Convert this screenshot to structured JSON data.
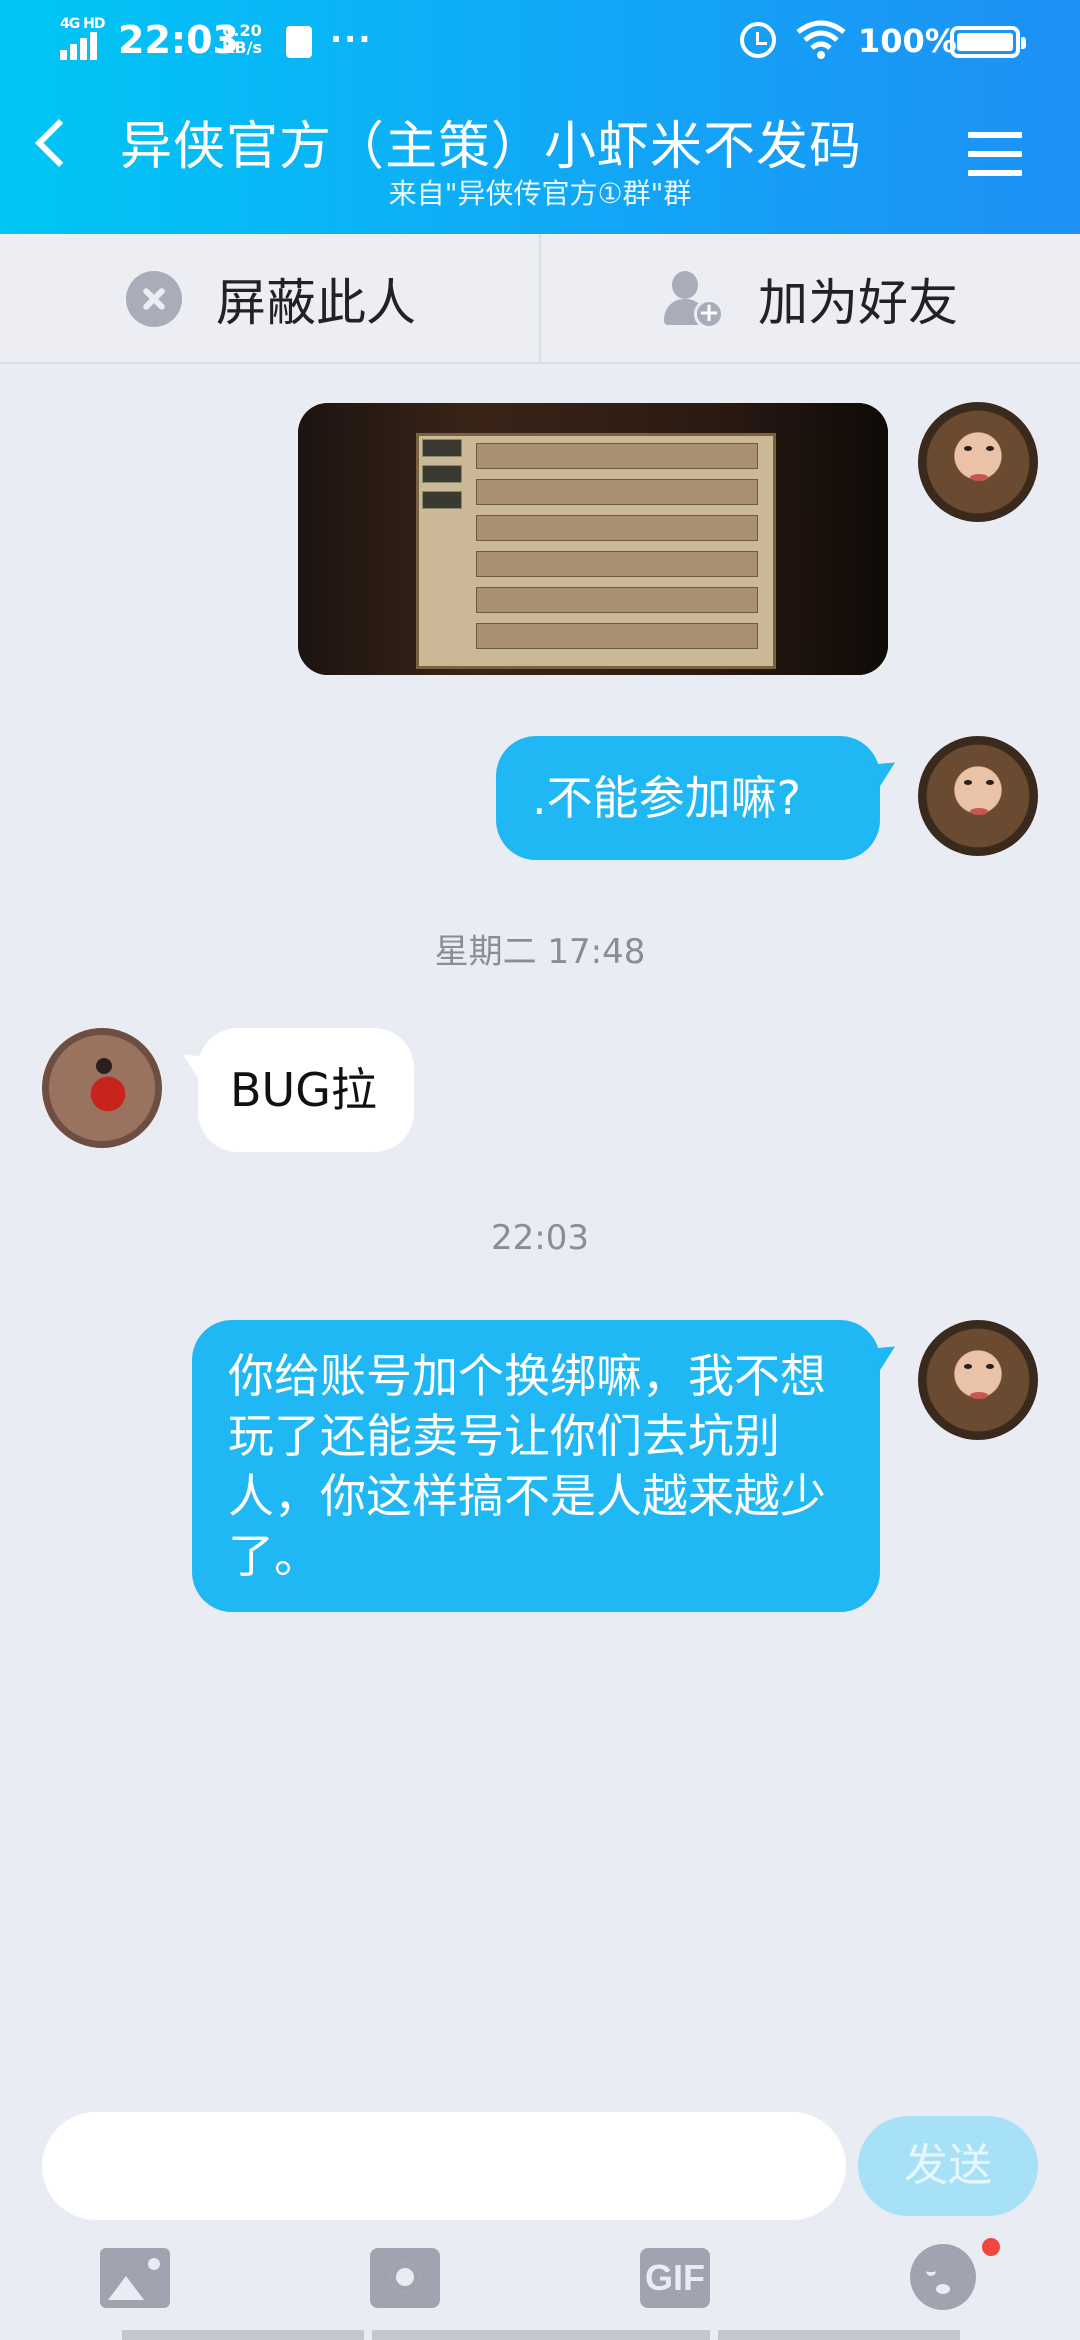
{
  "status_bar": {
    "network": "4G HD",
    "time": "22:03",
    "speed_value": "0.20",
    "speed_unit": "KB/s",
    "more": "···",
    "battery": "100%"
  },
  "header": {
    "title": "异侠官方（主策）小虾米不发码",
    "subtitle": "来自\"异侠传官方①群\"群"
  },
  "actions": {
    "block_label": "屏蔽此人",
    "add_friend_label": "加为好友"
  },
  "messages": [
    {
      "type": "image",
      "sender": "me",
      "description": "game-screenshot"
    },
    {
      "type": "text",
      "sender": "me",
      "text": ".不能参加嘛?"
    },
    {
      "type": "timestamp",
      "text": "星期二 17:48"
    },
    {
      "type": "text",
      "sender": "other",
      "text": "BUG拉"
    },
    {
      "type": "timestamp",
      "text": "22:03"
    },
    {
      "type": "text",
      "sender": "me",
      "text": "你给账号加个换绑嘛，我不想玩了还能卖号让你们去坑别人，你这样搞不是人越来越少了。"
    }
  ],
  "input": {
    "value": "",
    "send_label": "发送"
  },
  "toolbar": {
    "gif_label": "GIF"
  },
  "colors": {
    "header_start": "#00c6f5",
    "header_end": "#1e90f6",
    "bubble_out": "#20b7f5",
    "bubble_in": "#ffffff",
    "background": "#eaecf3"
  }
}
